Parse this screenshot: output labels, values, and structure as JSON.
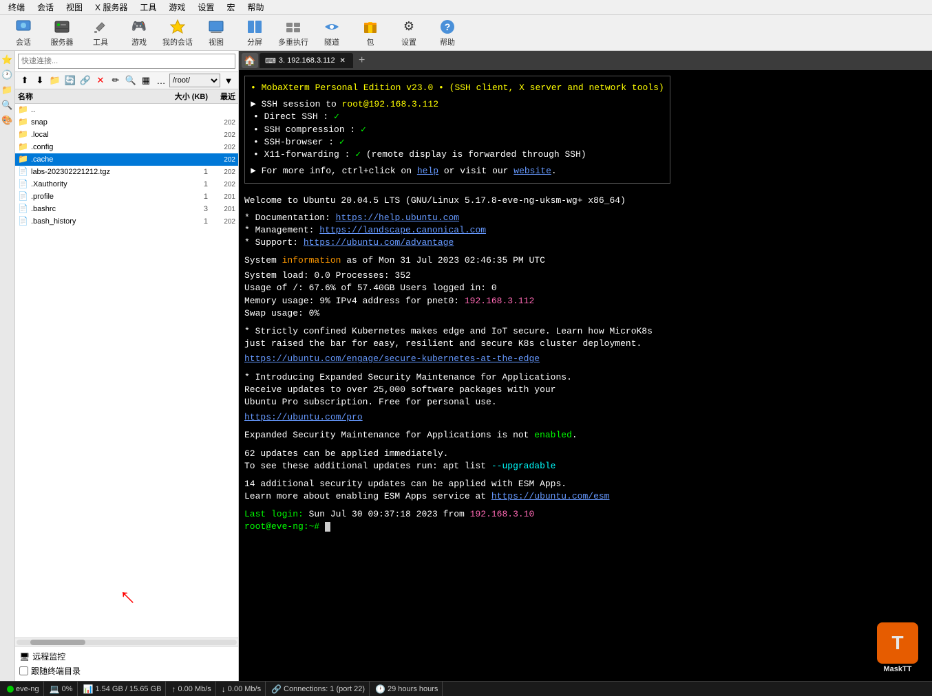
{
  "menubar": {
    "items": [
      "终端",
      "会话",
      "视图",
      "X 服务器",
      "工具",
      "游戏",
      "设置",
      "宏",
      "帮助"
    ]
  },
  "toolbar": {
    "buttons": [
      {
        "label": "会话",
        "icon": "💬"
      },
      {
        "label": "服务器",
        "icon": "🖥"
      },
      {
        "label": "工具",
        "icon": "🔧"
      },
      {
        "label": "游戏",
        "icon": "🎮"
      },
      {
        "label": "我的会话",
        "icon": "⭐"
      },
      {
        "label": "视图",
        "icon": "🖥"
      },
      {
        "label": "分屏",
        "icon": "▦"
      },
      {
        "label": "多重执行",
        "icon": "⚡"
      },
      {
        "label": "隧道",
        "icon": "🔗"
      },
      {
        "label": "包",
        "icon": "📦"
      },
      {
        "label": "设置",
        "icon": "⚙"
      },
      {
        "label": "帮助",
        "icon": "❓"
      }
    ]
  },
  "sidebar": {
    "search_placeholder": "快速连接...",
    "path": "/root/",
    "columns": {
      "name": "名称",
      "size": "大小 (KB)",
      "date": "最近"
    },
    "files": [
      {
        "name": "..",
        "icon": "📁",
        "type": "folder",
        "size": "",
        "date": ""
      },
      {
        "name": "snap",
        "icon": "📁",
        "type": "folder",
        "size": "",
        "date": "202"
      },
      {
        "name": ".local",
        "icon": "📁",
        "type": "folder",
        "size": "",
        "date": "202"
      },
      {
        "name": ".config",
        "icon": "📁",
        "type": "folder",
        "size": "",
        "date": "202"
      },
      {
        "name": ".cache",
        "icon": "📁",
        "type": "folder",
        "size": "",
        "date": "202",
        "selected": true
      },
      {
        "name": "labs-202302221212.tgz",
        "icon": "📄",
        "type": "file",
        "size": "1",
        "date": "202"
      },
      {
        "name": ".Xauthority",
        "icon": "📄",
        "type": "file",
        "size": "1",
        "date": "202"
      },
      {
        "name": ".profile",
        "icon": "📄",
        "type": "file",
        "size": "1",
        "date": "201"
      },
      {
        "name": ".bashrc",
        "icon": "📄",
        "type": "file",
        "size": "3",
        "date": "201"
      },
      {
        "name": ".bash_history",
        "icon": "📄",
        "type": "file",
        "size": "1",
        "date": "202"
      }
    ],
    "remote_monitor": "远程监控",
    "follow_dir": "跟随终端目录"
  },
  "terminal": {
    "tab_label": "3. 192.168.3.112",
    "content": {
      "mobaxterm_banner": "• MobaXterm Personal Edition v23.0 •\n(SSH client, X server and network tools)",
      "ssh_session": "► SSH session to root@192.168.3.112",
      "ssh_details": [
        "• Direct SSH      : ✓",
        "• SSH compression : ✓",
        "• SSH-browser     : ✓",
        "• X11-forwarding  : ✓  (remote display is forwarded through SSH)"
      ],
      "help_text": "► For more info, ctrl+click on help or visit our website.",
      "welcome": "Welcome to Ubuntu 20.04.5 LTS (GNU/Linux 5.17.8-eve-ng-uksm-wg+ x86_64)",
      "doc_line": "* Documentation:  https://help.ubuntu.com",
      "mgmt_line": "* Management:     https://landscape.canonical.com",
      "support_line": "* Support:        https://ubuntu.com/advantage",
      "sysinfo": "System information as of Mon 31 Jul 2023 02:46:35 PM UTC",
      "sysload": "System load:  0.0",
      "processes": "Processes:           352",
      "usage": "Usage of /:   67.6% of 57.40GB",
      "users": "Users logged in:     0",
      "memory": "Memory usage: 9%",
      "ipv4": "IPv4 address for pnet0: 192.168.3.112",
      "swap": "Swap usage:   0%",
      "k8s_msg1": "* Strictly confined Kubernetes makes edge and IoT secure. Learn how MicroK8s",
      "k8s_msg2": "  just raised the bar for easy, resilient and secure K8s cluster deployment.",
      "k8s_link": "  https://ubuntu.com/engage/secure-kubernetes-at-the-edge",
      "esm_msg1": "* Introducing Expanded Security Maintenance for Applications.",
      "esm_msg2": "  Receive updates to over 25,000 software packages with your",
      "esm_msg3": "  Ubuntu Pro subscription. Free for personal use.",
      "esm_link": "  https://ubuntu.com/pro",
      "esm_disabled": "Expanded Security Maintenance for Applications is not enabled.",
      "updates1": "62 updates can be applied immediately.",
      "upgradable": "To see these additional updates run: apt list --upgradable",
      "security_updates": "14 additional security updates can be applied with ESM Apps.",
      "esm_service": "Learn more about enabling ESM Apps service at https://ubuntu.com/esm",
      "last_login": "Last login: Sun Jul 30 09:37:18 2023 from 192.168.3.10",
      "prompt": "root@eve-ng:~# "
    }
  },
  "statusbar": {
    "session": "eve-ng",
    "cpu": "0%",
    "memory": "1.54 GB / 15.65 GB",
    "upload": "0.00 Mb/s",
    "download": "0.00 Mb/s",
    "connections": "Connections: 1 (port 22)",
    "time": "29 hours"
  },
  "watermark": {
    "letter": "T",
    "text": "MaskTT"
  }
}
